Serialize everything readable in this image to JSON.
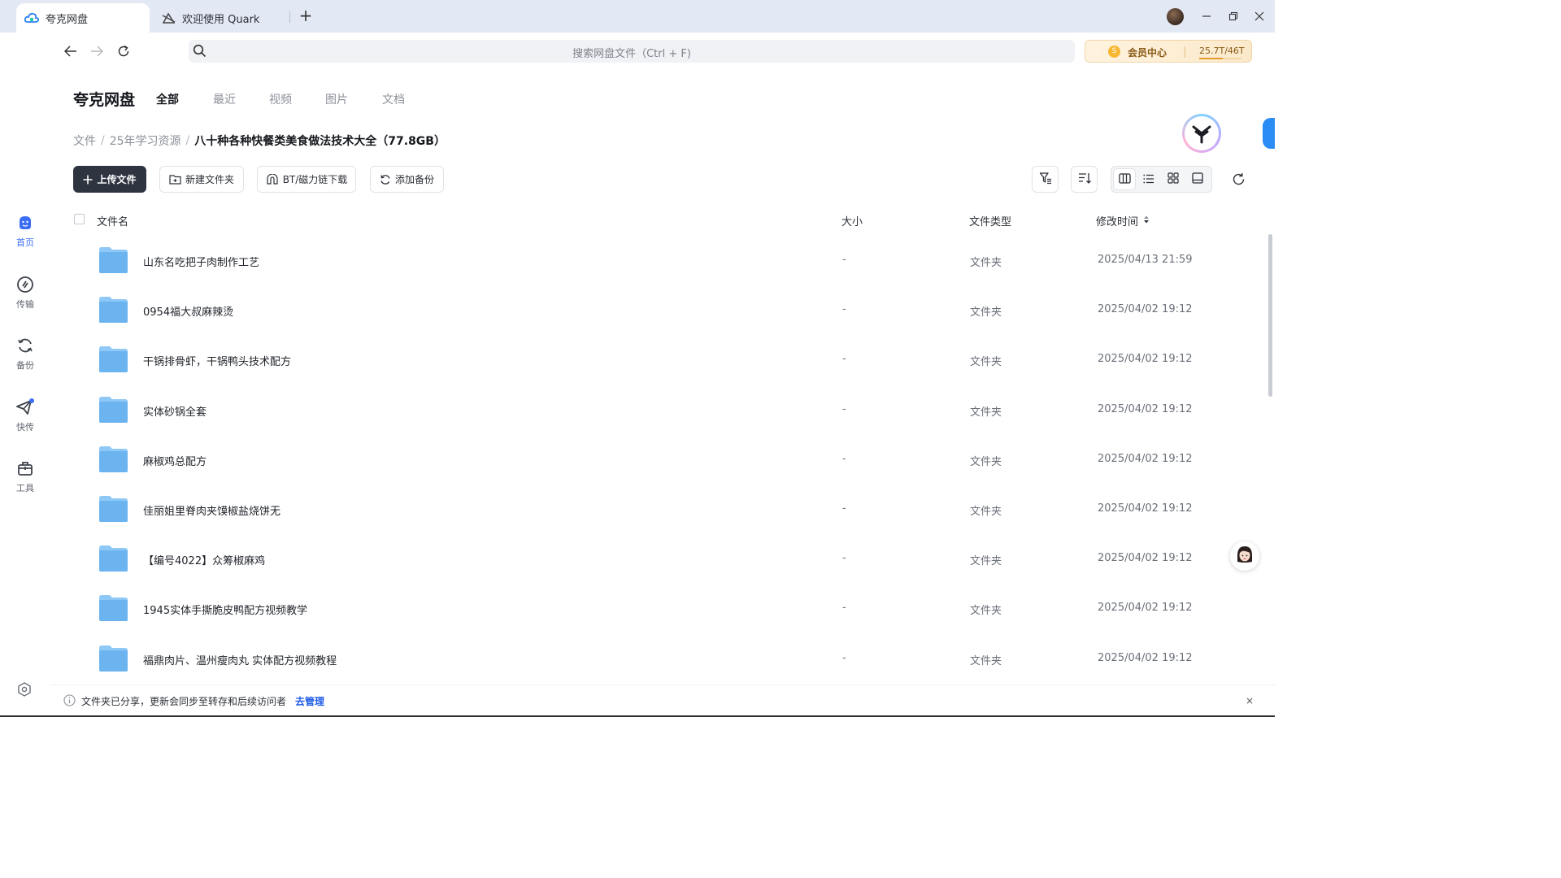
{
  "browser": {
    "tabs": [
      {
        "title": "夸克网盘",
        "icon": "cloud-icon",
        "active": true
      },
      {
        "title": "欢迎使用 Quark",
        "icon": "quark-icon",
        "active": false
      }
    ],
    "new_tab": "+"
  },
  "search": {
    "placeholder": "搜索网盘文件（Ctrl + F)"
  },
  "vip": {
    "label": "会员中心",
    "storage": "25.7T/46T",
    "used_fraction": 0.559
  },
  "sidebar": {
    "items": [
      {
        "label": "首页",
        "icon": "home-icon",
        "active": true
      },
      {
        "label": "传输",
        "icon": "transfer-icon",
        "active": false
      },
      {
        "label": "备份",
        "icon": "backup-icon",
        "active": false
      },
      {
        "label": "快传",
        "icon": "send-icon",
        "active": false,
        "badge": true
      },
      {
        "label": "工具",
        "icon": "toolbox-icon",
        "active": false
      }
    ]
  },
  "header": {
    "brand": "夸克网盘",
    "tabs": [
      "全部",
      "最近",
      "视频",
      "图片",
      "文档"
    ],
    "active_tab": "全部"
  },
  "breadcrumb": {
    "root": "文件",
    "parent": "25年学习资源",
    "current": "八十种各种快餐类美食做法技术大全（77.8GB）",
    "separator": "/"
  },
  "toolbar": {
    "upload": "上传文件",
    "new_folder": "新建文件夹",
    "bt_download": "BT/磁力链下载",
    "add_backup": "添加备份"
  },
  "table": {
    "headers": {
      "name": "文件名",
      "size": "大小",
      "type": "文件类型",
      "modified": "修改时间"
    },
    "rows": [
      {
        "name": "山东名吃把子肉制作工艺",
        "size": "-",
        "type": "文件夹",
        "modified": "2025/04/13 21:59"
      },
      {
        "name": "0954福大叔麻辣烫",
        "size": "-",
        "type": "文件夹",
        "modified": "2025/04/02 19:12"
      },
      {
        "name": "干锅排骨虾，干锅鸭头技术配方",
        "size": "-",
        "type": "文件夹",
        "modified": "2025/04/02 19:12"
      },
      {
        "name": "实体砂锅全套",
        "size": "-",
        "type": "文件夹",
        "modified": "2025/04/02 19:12"
      },
      {
        "name": "麻椒鸡总配方",
        "size": "-",
        "type": "文件夹",
        "modified": "2025/04/02 19:12"
      },
      {
        "name": "佳丽姐里脊肉夹馍椒盐烧饼无",
        "size": "-",
        "type": "文件夹",
        "modified": "2025/04/02 19:12"
      },
      {
        "name": "【编号4022】众筹椒麻鸡",
        "size": "-",
        "type": "文件夹",
        "modified": "2025/04/02 19:12"
      },
      {
        "name": "1945实体手撕脆皮鸭配方视频教学",
        "size": "-",
        "type": "文件夹",
        "modified": "2025/04/02 19:12"
      },
      {
        "name": "福鼎肉片、温州瘦肉丸  实体配方视频教程",
        "size": "-",
        "type": "文件夹",
        "modified": "2025/04/02 19:12"
      }
    ]
  },
  "notice": {
    "text": "文件夹已分享，更新会同步至转存和后续访问者",
    "link": "去管理",
    "close": "×"
  },
  "colors": {
    "accent": "#3b6df5",
    "primary_button": "#2e3440",
    "folder": "#6cb4f0",
    "link": "#1f5ce6"
  }
}
